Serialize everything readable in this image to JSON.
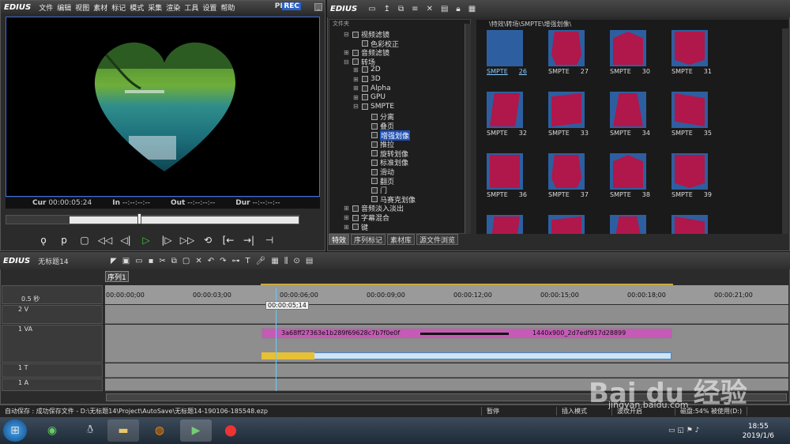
{
  "player": {
    "app_name": "EDIUS",
    "menu": [
      "文件",
      "编辑",
      "视图",
      "素材",
      "标记",
      "模式",
      "采集",
      "渲染",
      "工具",
      "设置",
      "帮助"
    ],
    "plr": "PLR",
    "rec": "REC",
    "cur_label": "Cur",
    "cur_value": "00:00:05:24",
    "in_label": "In",
    "in_value": "--:--:--:--",
    "out_label": "Out",
    "out_value": "--:--:--:--",
    "dur_label": "Dur",
    "dur_value": "--:--:--:--",
    "scrub_position": 0.45
  },
  "browser": {
    "app_name": "EDIUS",
    "tree_header": "文件夹",
    "tree": [
      {
        "label": "视频滤镜",
        "indent": 1,
        "expanded": true
      },
      {
        "label": "色彩校正",
        "indent": 2
      },
      {
        "label": "音频滤镜",
        "indent": 1
      },
      {
        "label": "转场",
        "indent": 1,
        "expanded": true
      },
      {
        "label": "2D",
        "indent": 2
      },
      {
        "label": "3D",
        "indent": 2
      },
      {
        "label": "Alpha",
        "indent": 2
      },
      {
        "label": "GPU",
        "indent": 2
      },
      {
        "label": "SMPTE",
        "indent": 2,
        "expanded": true
      },
      {
        "label": "分离",
        "indent": 3
      },
      {
        "label": "叠页",
        "indent": 3
      },
      {
        "label": "增强划像",
        "indent": 3,
        "selected": true
      },
      {
        "label": "推拉",
        "indent": 3
      },
      {
        "label": "旋转划像",
        "indent": 3
      },
      {
        "label": "标准划像",
        "indent": 3
      },
      {
        "label": "滑动",
        "indent": 3
      },
      {
        "label": "翻页",
        "indent": 3
      },
      {
        "label": "门",
        "indent": 3
      },
      {
        "label": "马赛克划像",
        "indent": 3
      },
      {
        "label": "音频淡入淡出",
        "indent": 1
      },
      {
        "label": "字幕混合",
        "indent": 1
      },
      {
        "label": "键",
        "indent": 1
      }
    ],
    "tabs": [
      "特效",
      "序列标记",
      "素材库",
      "源文件浏览"
    ],
    "active_tab": 0,
    "path": "\\特效\\转场\\SMPTE\\增强划像\\",
    "thumbs": [
      {
        "name": "SMPTE",
        "num": "26",
        "letter": "A",
        "selected": true
      },
      {
        "name": "SMPTE",
        "num": "27",
        "letter": "B"
      },
      {
        "name": "SMPTE",
        "num": "30",
        "letter": "B"
      },
      {
        "name": "SMPTE",
        "num": "31",
        "letter": "B"
      },
      {
        "name": "SMPTE",
        "num": "32",
        "letter": "B"
      },
      {
        "name": "SMPTE",
        "num": "33",
        "letter": "B"
      },
      {
        "name": "SMPTE",
        "num": "34",
        "letter": "B"
      },
      {
        "name": "SMPTE",
        "num": "35",
        "letter": "B"
      },
      {
        "name": "SMPTE",
        "num": "36",
        "letter": "B"
      },
      {
        "name": "SMPTE",
        "num": "37",
        "letter": "B"
      },
      {
        "name": "SMPTE",
        "num": "38",
        "letter": "B"
      },
      {
        "name": "SMPTE",
        "num": "39",
        "letter": "B"
      },
      {
        "name": "",
        "num": "",
        "letter": "B"
      },
      {
        "name": "",
        "num": "",
        "letter": "B"
      },
      {
        "name": "",
        "num": "",
        "letter": "B"
      },
      {
        "name": "",
        "num": "",
        "letter": "B"
      }
    ]
  },
  "timeline": {
    "app_name": "EDIUS",
    "project": "无标题14",
    "sequence_tab": "序列1",
    "zoom": "0.5 秒",
    "ruler": [
      "00:00:00;00",
      "00:00:03;00",
      "00:00:06;00",
      "00:00:09;00",
      "00:00:12;00",
      "00:00:15;00",
      "00:00:18;00",
      "00:00:21;00"
    ],
    "cursor_time": "00:00:05;14",
    "tracks": [
      {
        "label": "2 V"
      },
      {
        "label": "1 VA"
      },
      {
        "label": "1 T"
      },
      {
        "label": "1 A"
      }
    ],
    "clip_a": "3a68ff27363e1b289f69628c7b7f0e0f",
    "clip_b": "1440x900_2d7edf917d28899"
  },
  "status": {
    "autosave": "自动保存 : 成功保存文件 - D:\\无标题14\\Project\\AutoSave\\无标题14-190106-185548.ezp",
    "pause": "暂停",
    "insert_mode": "插入模式",
    "ripple": "波纹开启",
    "disk": "磁盘:54% 被使用(D:)"
  },
  "taskbar": {
    "time": "18:55",
    "date": "2019/1/6"
  },
  "watermark": {
    "logo": "Bai du 经验",
    "url": "jingyan.baidu.com"
  }
}
